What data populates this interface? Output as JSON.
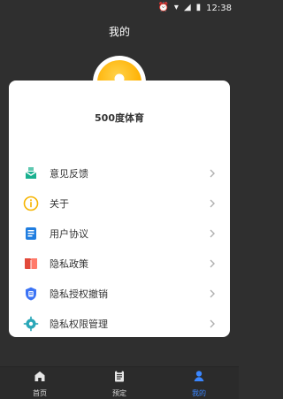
{
  "statusbar": {
    "time": "12:38"
  },
  "header": {
    "title": "我的"
  },
  "profile": {
    "name": "500度体育"
  },
  "menu": {
    "items": [
      {
        "label": "意见反馈",
        "icon": "feedback-icon"
      },
      {
        "label": "关于",
        "icon": "info-icon"
      },
      {
        "label": "用户协议",
        "icon": "document-icon"
      },
      {
        "label": "隐私政策",
        "icon": "book-icon"
      },
      {
        "label": "隐私授权撤销",
        "icon": "shield-icon"
      },
      {
        "label": "隐私权限管理",
        "icon": "gear-icon"
      }
    ]
  },
  "bottom_nav": {
    "items": [
      {
        "label": "首页",
        "icon": "home-icon"
      },
      {
        "label": "预定",
        "icon": "clipboard-icon"
      },
      {
        "label": "我的",
        "icon": "user-icon"
      }
    ]
  },
  "colors": {
    "accent": "#3a86ff",
    "page_bg": "#2f2f2f",
    "card_bg": "#ffffff"
  }
}
